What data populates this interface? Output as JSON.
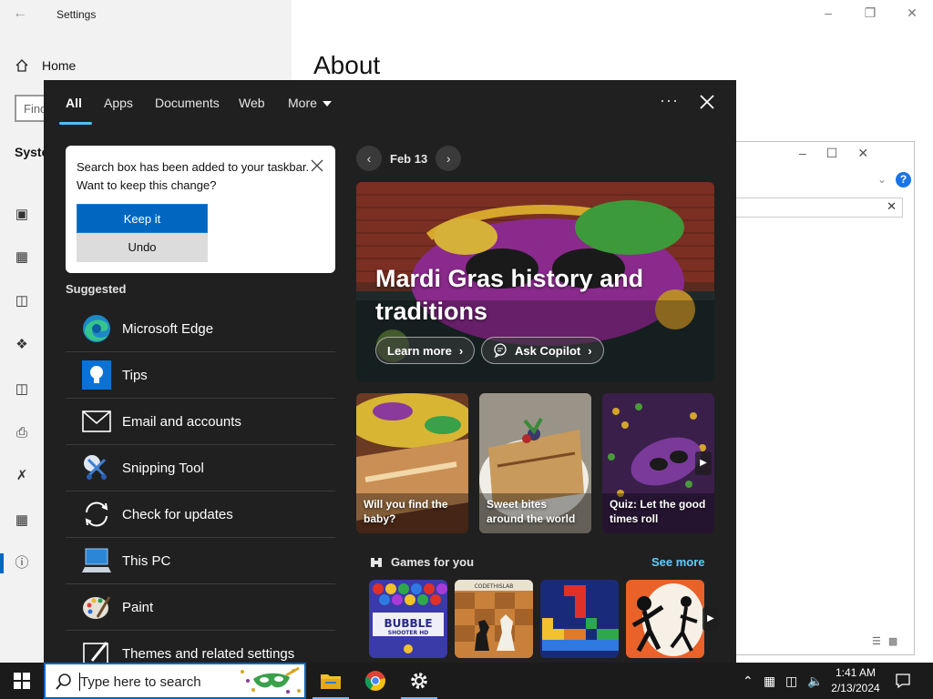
{
  "settings": {
    "title": "Settings",
    "home_label": "Home",
    "find_placeholder": "Find",
    "section_label": "System",
    "page_heading": "About"
  },
  "flyout": {
    "tabs": [
      {
        "label": "All",
        "active": true
      },
      {
        "label": "Apps"
      },
      {
        "label": "Documents"
      },
      {
        "label": "Web"
      },
      {
        "label": "More"
      }
    ],
    "more_options": "···",
    "notification": {
      "text": "Search box has been added to your taskbar. Want to keep this change?",
      "keep_label": "Keep it",
      "undo_label": "Undo"
    },
    "suggested_heading": "Suggested",
    "suggested": [
      {
        "label": "Microsoft Edge",
        "icon": "edge-icon"
      },
      {
        "label": "Tips",
        "icon": "tips-icon"
      },
      {
        "label": "Email and accounts",
        "icon": "mail-icon"
      },
      {
        "label": "Snipping Tool",
        "icon": "snipping-tool-icon"
      },
      {
        "label": "Check for updates",
        "icon": "sync-icon"
      },
      {
        "label": "This PC",
        "icon": "computer-icon"
      },
      {
        "label": "Paint",
        "icon": "paint-icon"
      },
      {
        "label": "Themes and related settings",
        "icon": "brush-icon"
      }
    ],
    "date_label": "Feb 13",
    "hero": {
      "title": "Mardi Gras history and traditions",
      "learn_more": "Learn more",
      "ask_copilot": "Ask Copilot"
    },
    "tiles": [
      {
        "caption": "Will you find the baby?"
      },
      {
        "caption": "Sweet bites around the world"
      },
      {
        "caption": "Quiz: Let the good times roll"
      }
    ],
    "games_heading": "Games for you",
    "see_more": "See more",
    "games": [
      {
        "name": "BUBBLE",
        "subname": "SHOOTER HD"
      },
      {
        "name": "CODETHISLAB"
      },
      {
        "name": ""
      },
      {
        "name": ""
      }
    ]
  },
  "taskbar": {
    "search_placeholder": "Type here to search",
    "clock_time": "1:41 AM",
    "clock_date": "2/13/2024"
  },
  "colors": {
    "accent": "#0067c0",
    "flyout_bg": "#202020",
    "link": "#60cdff",
    "tab_underline": "#4cc2ff"
  }
}
